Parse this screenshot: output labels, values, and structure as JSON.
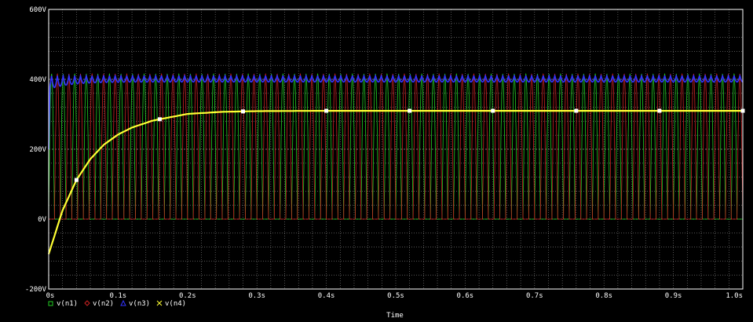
{
  "chart_data": {
    "type": "line",
    "xlabel": "Time",
    "ylabel": "",
    "xlim": [
      0,
      1.0
    ],
    "ylim": [
      -200,
      600
    ],
    "x_ticks": [
      "0s",
      "0.1s",
      "0.2s",
      "0.3s",
      "0.4s",
      "0.5s",
      "0.6s",
      "0.7s",
      "0.8s",
      "0.9s",
      "1.0s"
    ],
    "y_ticks": [
      "-200V",
      "0V",
      "200V",
      "400V",
      "600V"
    ],
    "grid": true,
    "legend_position": "bottom-left",
    "series": [
      {
        "name": "v(n1)",
        "color": "#22cc22",
        "marker": "square",
        "description_values": {
          "min": 0,
          "max": 415,
          "frequency_hz": 60
        }
      },
      {
        "name": "v(n2)",
        "color": "#cc2222",
        "marker": "diamond",
        "description_values": {
          "min": 0,
          "max": 415,
          "frequency_hz": 60
        }
      },
      {
        "name": "v(n3)",
        "color": "#3333ff",
        "marker": "triangle",
        "description_values": {
          "min": 385,
          "max": 420,
          "steady": 410
        }
      },
      {
        "name": "v(n4)",
        "color": "#ffff33",
        "marker": "x",
        "x": [
          0,
          0.02,
          0.04,
          0.06,
          0.08,
          0.1,
          0.12,
          0.15,
          0.2,
          0.25,
          0.3,
          0.4,
          0.5,
          0.6,
          0.7,
          0.8,
          0.9,
          1.0
        ],
        "y": [
          -100,
          25,
          112,
          172,
          214,
          242,
          262,
          282,
          301,
          307,
          309,
          310,
          310,
          310,
          310,
          310,
          310,
          310
        ]
      }
    ]
  }
}
